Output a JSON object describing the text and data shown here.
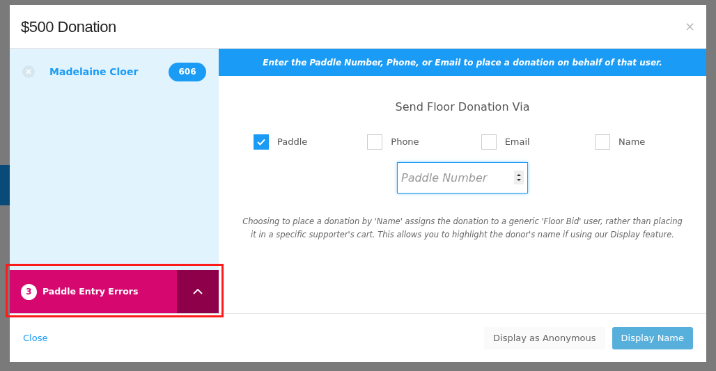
{
  "modal": {
    "title": "$500 Donation",
    "close": "×"
  },
  "donors": [
    {
      "name": "Madelaine Cloer",
      "paddle": "606"
    }
  ],
  "errors": {
    "count": "3",
    "label": "Paddle Entry Errors",
    "expanded": false
  },
  "banner": "Enter the Paddle Number, Phone, or Email to place a donation on behalf of that user.",
  "heading": "Send Floor Donation Via",
  "options": [
    {
      "label": "Paddle",
      "checked": true
    },
    {
      "label": "Phone",
      "checked": false
    },
    {
      "label": "Email",
      "checked": false
    },
    {
      "label": "Name",
      "checked": false
    }
  ],
  "input": {
    "placeholder": "Paddle Number"
  },
  "note": "Choosing to place a donation by 'Name' assigns the donation to a generic 'Floor Bid' user, rather than placing it in a specific supporter's cart. This allows you to highlight the donor's name if using our Display feature.",
  "footer": {
    "close": "Close",
    "buttons": [
      "Display as Anonymous",
      "Display Name"
    ]
  }
}
